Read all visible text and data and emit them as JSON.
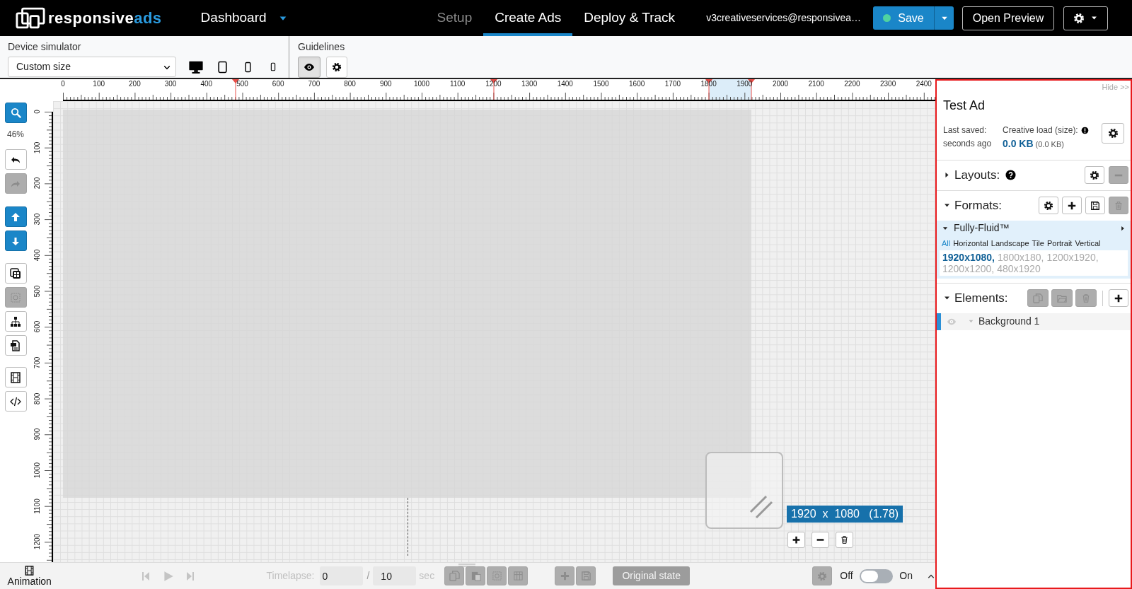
{
  "header": {
    "logo_text": "responsive",
    "logo_accent": "ads",
    "menu": "Dashboard",
    "nav": [
      {
        "label": "Setup",
        "selected": false,
        "disabled": true
      },
      {
        "label": "Create Ads",
        "selected": true,
        "disabled": false
      },
      {
        "label": "Deploy & Track",
        "selected": false,
        "disabled": false
      }
    ],
    "user": "v3creativeservices@responsivea…",
    "save": "Save",
    "preview": "Open Preview"
  },
  "toolbar": {
    "device_label": "Device simulator",
    "device_value": "Custom size",
    "guidelines_label": "Guidelines",
    "guidelines_on": true
  },
  "ruler": {
    "x_labels": [
      "0",
      "100",
      "200",
      "300",
      "400",
      "500",
      "600",
      "700",
      "800",
      "900",
      "1000",
      "1100",
      "1200",
      "1300",
      "1400",
      "1500",
      "1600",
      "1700",
      "1800",
      "1900",
      "2000",
      "2100",
      "2200",
      "2300",
      "2400"
    ],
    "y_labels": [
      "0",
      "100",
      "200",
      "300",
      "400",
      "500",
      "600",
      "700",
      "800",
      "900",
      "1000",
      "1100",
      "1200"
    ]
  },
  "tools": {
    "zoom": {
      "kind": "zoom",
      "primary": true,
      "disabled": false,
      "level": "46%"
    },
    "groups": [
      [
        {
          "kind": "undo",
          "primary": false,
          "disabled": false
        },
        {
          "kind": "redo",
          "primary": false,
          "disabled": true
        }
      ],
      [
        {
          "kind": "up",
          "primary": true,
          "disabled": false
        },
        {
          "kind": "down",
          "primary": true,
          "disabled": false
        }
      ],
      [
        {
          "kind": "layers",
          "primary": false,
          "disabled": false
        },
        {
          "kind": "frame",
          "primary": false,
          "disabled": true
        },
        {
          "kind": "tree",
          "primary": false,
          "disabled": false
        },
        {
          "kind": "import",
          "primary": false,
          "disabled": false
        }
      ],
      [
        {
          "kind": "film",
          "primary": false,
          "disabled": false
        },
        {
          "kind": "code",
          "primary": false,
          "disabled": false
        }
      ]
    ]
  },
  "canvas": {
    "size_label": "1920  x  1080   (1.78)",
    "buttons": [
      {
        "kind": "add",
        "disabled": false
      },
      {
        "kind": "remove",
        "disabled": false
      },
      {
        "kind": "delete",
        "disabled": false
      }
    ]
  },
  "timeline": {
    "label": "Animation",
    "timelapse_label": "Timelapse:",
    "start": "0",
    "separator": "/",
    "end": "10",
    "unit": "sec",
    "buttons": [
      {
        "kind": "copy",
        "disabled": true
      },
      {
        "kind": "paste",
        "disabled": true
      },
      {
        "kind": "frame",
        "disabled": true
      },
      {
        "kind": "grid",
        "disabled": true
      }
    ],
    "buttons_2": [
      {
        "kind": "add",
        "disabled": true
      },
      {
        "kind": "save",
        "disabled": true
      }
    ],
    "original_state": "Original state",
    "settings": {
      "kind": "settings",
      "disabled": true
    },
    "off_label": "Off",
    "on_label": "On",
    "on": false
  },
  "panel": {
    "hide": "Hide >>",
    "title": "Test Ad",
    "saved_label": "Last saved:",
    "saved_value": "seconds ago",
    "load_label": "Creative load (size):",
    "load_value": "0.0 KB",
    "load_detail": "(0.0 KB)",
    "settings": {
      "kind": "settings",
      "disabled": false
    },
    "layouts": {
      "label": "Layouts:",
      "expanded": false,
      "buttons": [
        {
          "kind": "settings",
          "disabled": false
        },
        {
          "kind": "remove",
          "disabled": true
        }
      ]
    },
    "formats": {
      "label": "Formats:",
      "expanded": true,
      "buttons": [
        {
          "kind": "settings",
          "disabled": false
        },
        {
          "kind": "add",
          "disabled": false
        },
        {
          "kind": "save",
          "disabled": false
        },
        {
          "kind": "delete",
          "disabled": true
        }
      ],
      "groups": [
        {
          "name": "Fully-Fluid™",
          "expanded": true,
          "filters": [
            {
              "label": "All",
              "selected": true
            },
            {
              "label": "Horizontal",
              "selected": false
            },
            {
              "label": "Landscape",
              "selected": false
            },
            {
              "label": "Tile",
              "selected": false
            },
            {
              "label": "Portrait",
              "selected": false
            },
            {
              "label": "Vertical",
              "selected": false
            }
          ],
          "sizes": [
            {
              "label": "1920x1080,",
              "selected": true
            },
            {
              "label": "1800x180,",
              "selected": false
            },
            {
              "label": "1200x1920,",
              "selected": false
            },
            {
              "label": "1200x1200,",
              "selected": false
            },
            {
              "label": "480x1920",
              "selected": false
            }
          ]
        }
      ]
    },
    "elements": {
      "label": "Elements:",
      "expanded": true,
      "buttons": [
        {
          "kind": "copy",
          "disabled": true
        },
        {
          "kind": "open",
          "disabled": true
        },
        {
          "kind": "delete",
          "disabled": true
        }
      ],
      "add": {
        "kind": "add",
        "disabled": false
      },
      "items": [
        {
          "name": "Background 1",
          "selected": true
        }
      ]
    }
  }
}
